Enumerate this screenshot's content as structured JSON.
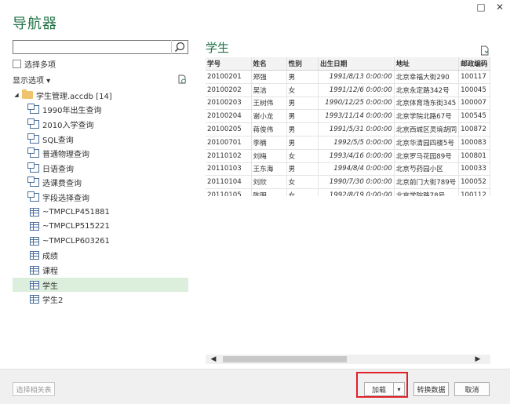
{
  "window": {
    "title": "导航器",
    "minimize_glyph": "□",
    "close_glyph": "✕"
  },
  "left": {
    "search_placeholder": "",
    "multi_select_label": "选择多项",
    "display_options_label": "显示选项 ▾",
    "root": {
      "label": "学生管理.accdb [14]"
    },
    "items": [
      {
        "label": "1990年出生查询",
        "type": "query"
      },
      {
        "label": "2010入学查询",
        "type": "query"
      },
      {
        "label": "SQL查询",
        "type": "query"
      },
      {
        "label": "普通物理查询",
        "type": "query"
      },
      {
        "label": "日语查询",
        "type": "query"
      },
      {
        "label": "选课费查询",
        "type": "query"
      },
      {
        "label": "字段选择查询",
        "type": "query"
      },
      {
        "label": "~TMPCLP451881",
        "type": "table"
      },
      {
        "label": "~TMPCLP515221",
        "type": "table"
      },
      {
        "label": "~TMPCLP603261",
        "type": "table"
      },
      {
        "label": "成绩",
        "type": "table"
      },
      {
        "label": "课程",
        "type": "table"
      },
      {
        "label": "学生",
        "type": "table",
        "selected": true
      },
      {
        "label": "学生2",
        "type": "table"
      }
    ]
  },
  "preview": {
    "title": "学生",
    "columns": [
      "学号",
      "姓名",
      "性别",
      "出生日期",
      "地址",
      "邮政编码"
    ],
    "rows": [
      [
        "20100201",
        "郑强",
        "男",
        "1991/8/13 0:00:00",
        "北京幸福大街290",
        "100117"
      ],
      [
        "20100202",
        "吴洁",
        "女",
        "1991/12/6 0:00:00",
        "北京永定路342号",
        "100045"
      ],
      [
        "20100203",
        "王树伟",
        "男",
        "1990/12/25 0:00:00",
        "北京体育场东街345",
        "100007"
      ],
      [
        "20100204",
        "谢小龙",
        "男",
        "1993/11/14 0:00:00",
        "北京学院北路67号",
        "100545"
      ],
      [
        "20100205",
        "蒋俊伟",
        "男",
        "1991/5/31 0:00:00",
        "北京西城区灵境胡同",
        "100872"
      ],
      [
        "20100701",
        "李楠",
        "男",
        "1992/5/5 0:00:00",
        "北京华清园四楼5号",
        "100083"
      ],
      [
        "20110102",
        "刘梅",
        "女",
        "1993/4/16 0:00:00",
        "北京罗马花园89号",
        "100801"
      ],
      [
        "20110103",
        "王东海",
        "男",
        "1994/8/4 0:00:00",
        "北京芍药园小区",
        "100033"
      ],
      [
        "20110104",
        "刘欣",
        "女",
        "1990/7/30 0:00:00",
        "北京前门大街789号",
        "100052"
      ],
      [
        "20110105",
        "陈明",
        "女",
        "1992/8/19 0:00:00",
        "北京学院路78号",
        "100112"
      ]
    ]
  },
  "footer": {
    "select_related_label": "选择相关表",
    "load_label": "加载",
    "load_dropdown_glyph": "▾",
    "transform_label": "转换数据",
    "cancel_label": "取消"
  },
  "colors": {
    "accent": "#217346",
    "selection": "#dcefdc",
    "highlight_box": "#e0202a"
  }
}
